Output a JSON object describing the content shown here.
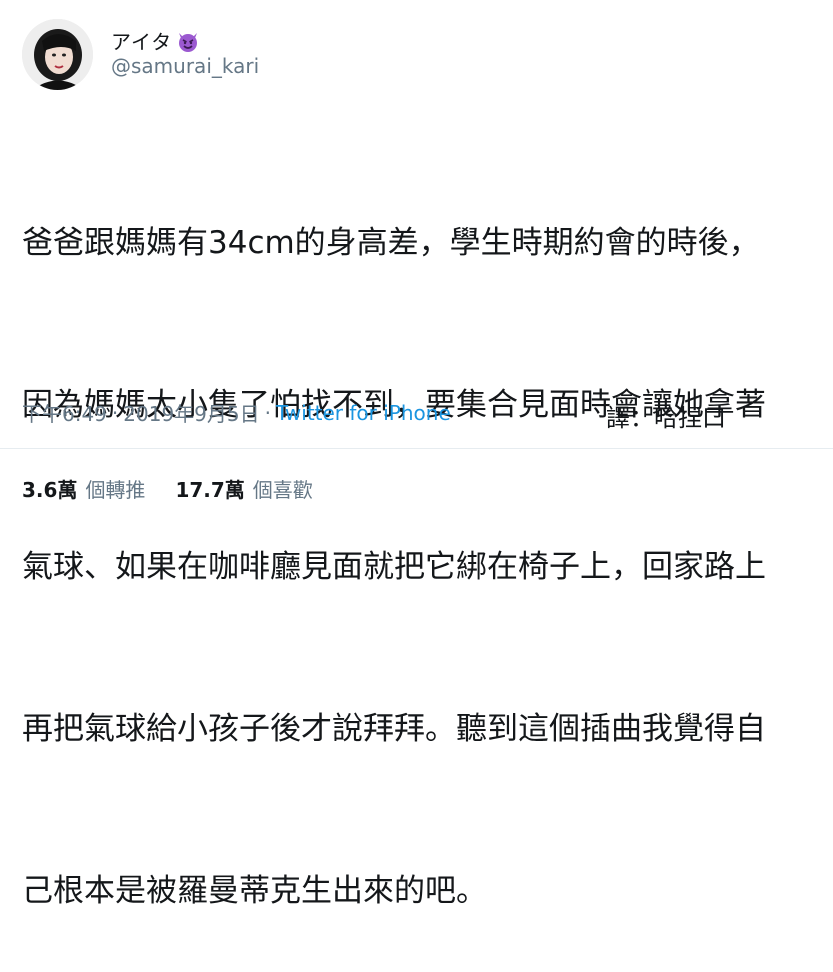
{
  "author": {
    "display_name": "アイタ",
    "emoji_icon": "smiling-devil-icon",
    "handle": "@samurai_kari",
    "avatar_icon": "avatar-photo"
  },
  "tweet": {
    "lines": [
      "爸爸跟媽媽有34cm的身高差，學生時期約會的時後，",
      "因為媽媽太小隻了怕找不到，要集合見面時會讓她拿著",
      "氣球、如果在咖啡廳見面就把它綁在椅子上，回家路上",
      "再把氣球給小孩子後才說拜拜。聽到這個插曲我覺得自",
      "己根本是被羅曼蒂克生出來的吧。"
    ]
  },
  "meta": {
    "time": "下午6:49",
    "separator": "·",
    "date": "2019年9月5日",
    "source": "Twitter for iPhone"
  },
  "translator_note": "譯：哈捏口",
  "stats": {
    "retweets_count": "3.6萬",
    "retweets_label": "個轉推",
    "likes_count": "17.7萬",
    "likes_label": "個喜歡"
  },
  "colors": {
    "link": "#1b95e0",
    "muted": "#657786",
    "text": "#14171a",
    "emoji_purple": "#9b59d0"
  }
}
